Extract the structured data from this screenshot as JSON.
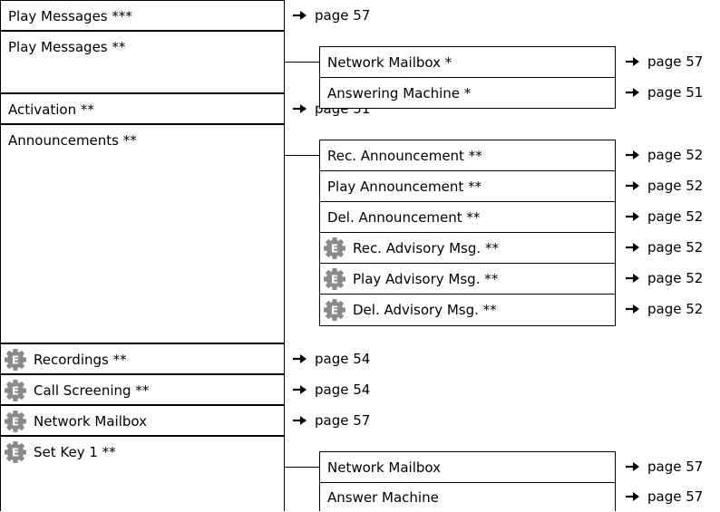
{
  "menu": {
    "play_messages_3": {
      "label": "Play Messages ***",
      "ref": "page 57"
    },
    "play_messages_2": {
      "label": "Play Messages **",
      "items": [
        {
          "label": "Network Mailbox *",
          "ref": "page 57"
        },
        {
          "label": "Answering Machine *",
          "ref": "page 51"
        }
      ]
    },
    "activation": {
      "label": "Activation **",
      "ref": "page 51"
    },
    "announcements": {
      "label": "Announcements **",
      "items": [
        {
          "label": "Rec. Announcement **",
          "ref": "page 52"
        },
        {
          "label": "Play Announcement **",
          "ref": "page 52"
        },
        {
          "label": "Del. Announcement **",
          "ref": "page 52"
        },
        {
          "label": "Rec. Advisory Msg. **",
          "ref": "page 52",
          "icon": "expert-mode-icon"
        },
        {
          "label": "Play Advisory Msg. **",
          "ref": "page 52",
          "icon": "expert-mode-icon"
        },
        {
          "label": "Del. Advisory Msg. **",
          "ref": "page 52",
          "icon": "expert-mode-icon"
        }
      ]
    },
    "recordings": {
      "label": "Recordings **",
      "ref": "page 54",
      "icon": "expert-mode-icon"
    },
    "call_screening": {
      "label": "Call Screening **",
      "ref": "page 54",
      "icon": "expert-mode-icon"
    },
    "network_mailbox": {
      "label": "Network Mailbox",
      "ref": "page 57",
      "icon": "expert-mode-icon"
    },
    "set_key_1": {
      "label": "Set Key 1 **",
      "icon": "expert-mode-icon",
      "items": [
        {
          "label": "Network Mailbox",
          "ref": "page 57"
        },
        {
          "label": "Answer Machine",
          "ref": "page 57"
        }
      ]
    }
  },
  "icon_badge_letter": "E",
  "colors": {
    "icon_gray": "#8a8a8a",
    "line": "#000000"
  }
}
